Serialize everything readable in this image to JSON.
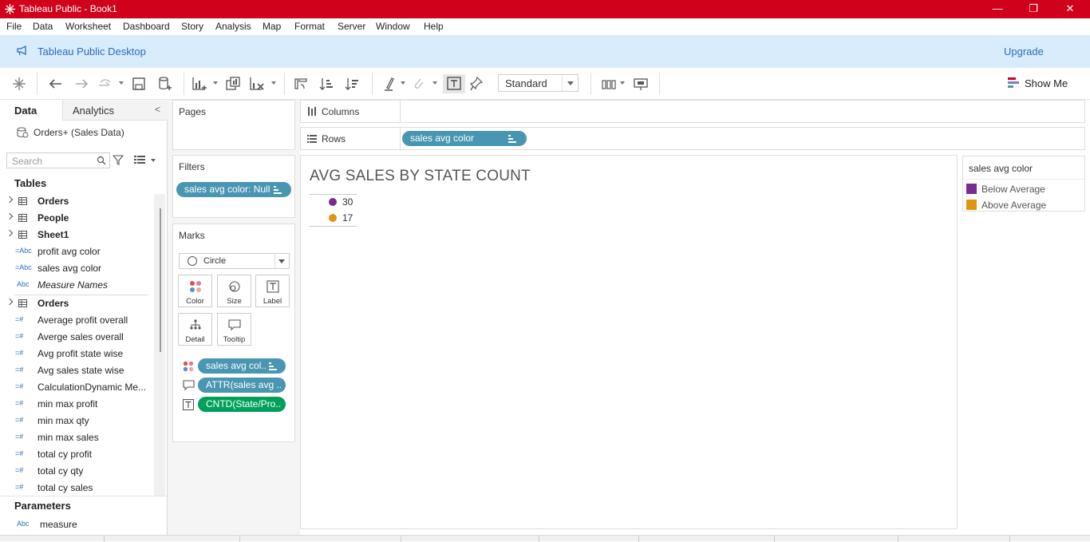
{
  "window": {
    "title": "Tableau Public - Book1",
    "minimize": "—",
    "maximize": "❐",
    "close": "✕"
  },
  "menu": [
    "File",
    "Data",
    "Worksheet",
    "Dashboard",
    "Story",
    "Analysis",
    "Map",
    "Format",
    "Server",
    "Window",
    "Help"
  ],
  "banner": {
    "title": "Tableau Public Desktop",
    "upgrade": "Upgrade"
  },
  "toolbar": {
    "fit_value": "Standard",
    "show_me": "Show Me"
  },
  "data_pane": {
    "tab_data": "Data",
    "tab_analytics": "Analytics",
    "collapse": "<",
    "datasource": "Orders+ (Sales Data)",
    "search_placeholder": "Search",
    "tables_title": "Tables",
    "fields": [
      {
        "label": "Orders",
        "type": "table"
      },
      {
        "label": "People",
        "type": "table"
      },
      {
        "label": "Sheet1",
        "type": "table"
      },
      {
        "label": "profit avg color",
        "type": "calc-dim",
        "icon": "=Abc"
      },
      {
        "label": "sales avg color",
        "type": "calc-dim",
        "icon": "=Abc"
      },
      {
        "label": "Measure Names",
        "type": "dim",
        "icon": "Abc"
      },
      {
        "label": "Orders",
        "type": "table"
      },
      {
        "label": "Average profit overall",
        "type": "calc-meas",
        "icon": "=#"
      },
      {
        "label": "Averge sales overall",
        "type": "calc-meas",
        "icon": "=#"
      },
      {
        "label": "Avg profit state wise",
        "type": "calc-meas",
        "icon": "=#"
      },
      {
        "label": "Avg sales state wise",
        "type": "calc-meas",
        "icon": "=#"
      },
      {
        "label": "CalculationDynamic Me...",
        "type": "calc-meas",
        "icon": "=#"
      },
      {
        "label": "min max  profit",
        "type": "calc-meas",
        "icon": "=#"
      },
      {
        "label": "min max  qty",
        "type": "calc-meas",
        "icon": "=#"
      },
      {
        "label": "min max sales",
        "type": "calc-meas",
        "icon": "=#"
      },
      {
        "label": "total cy profit",
        "type": "calc-meas",
        "icon": "=#"
      },
      {
        "label": "total cy qty",
        "type": "calc-meas",
        "icon": "=#"
      },
      {
        "label": "total cy sales",
        "type": "calc-meas",
        "icon": "=#"
      }
    ],
    "parameters_title": "Parameters",
    "parameter": {
      "label": "measure",
      "icon": "Abc"
    }
  },
  "cards": {
    "pages": "Pages",
    "filters": "Filters",
    "filter_pill": "sales avg color: Null",
    "marks": "Marks",
    "mark_type": "Circle",
    "buttons": {
      "color": "Color",
      "size": "Size",
      "label": "Label",
      "detail": "Detail",
      "tooltip": "Tooltip"
    },
    "mark_pills": [
      "sales avg col..",
      "ATTR(sales avg ..",
      "CNTD(State/Pro.."
    ]
  },
  "shelves": {
    "columns": "Columns",
    "rows": "Rows",
    "rows_pill": "sales avg color"
  },
  "viz": {
    "title": "AVG SALES BY STATE COUNT",
    "rows": [
      {
        "value": "30",
        "color": "#7b2a8e"
      },
      {
        "value": "17",
        "color": "#e0960c"
      }
    ]
  },
  "legend": {
    "title": "sales avg color",
    "items": [
      {
        "label": "Below Average",
        "color": "#7b2a8e"
      },
      {
        "label": "Above Average",
        "color": "#e0960c"
      }
    ]
  }
}
